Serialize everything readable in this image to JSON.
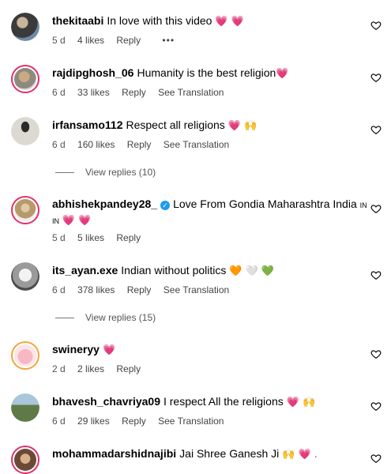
{
  "comments": [
    {
      "user": "thekitaabi",
      "text": "In love with this video",
      "emoji": "💗 💗",
      "time": "5 d",
      "likes": "4 likes",
      "reply": "Reply",
      "more": "•••"
    },
    {
      "user": "rajdipghosh_06",
      "text": "Humanity is the best religion",
      "emoji": "💗",
      "time": "6 d",
      "likes": "33 likes",
      "reply": "Reply",
      "translate": "See Translation"
    },
    {
      "user": "irfansamo112",
      "text": "Respect all religions",
      "emoji": "💗 🙌",
      "time": "6 d",
      "likes": "160 likes",
      "reply": "Reply",
      "translate": "See Translation",
      "view_replies": "View replies (10)"
    },
    {
      "user": "abhishekpandey28_",
      "text": "Love From Gondia Maharashtra India",
      "flag_text": "IN",
      "line2_flag": "IN",
      "emoji": "💗 💗",
      "time": "5 d",
      "likes": "5 likes",
      "reply": "Reply"
    },
    {
      "user": "its_ayan.exe",
      "text": "Indian without politics",
      "emoji": "🧡 🤍 💚",
      "time": "6 d",
      "likes": "378 likes",
      "reply": "Reply",
      "translate": "See Translation",
      "view_replies": "View replies (15)"
    },
    {
      "user": "swineryy",
      "text": "",
      "emoji": "💗",
      "time": "2 d",
      "likes": "2 likes",
      "reply": "Reply"
    },
    {
      "user": "bhavesh_chavriya09",
      "text": "I respect All the religions",
      "emoji": "💗 🙌",
      "time": "6 d",
      "likes": "29 likes",
      "reply": "Reply",
      "translate": "See Translation"
    },
    {
      "user": "mohammadarshidnajibi",
      "text": "Jai Shree Ganesh Ji",
      "emoji": "🙌 💗 ."
    }
  ],
  "colors": {
    "heart": "#e1306c",
    "ring": "#e1306c",
    "verified": "#1d9bf0",
    "meta_text": "#555555"
  },
  "icons": {
    "like": "heart-outline-icon",
    "verified": "verified-badge-icon",
    "more": "more-horizontal-icon"
  }
}
